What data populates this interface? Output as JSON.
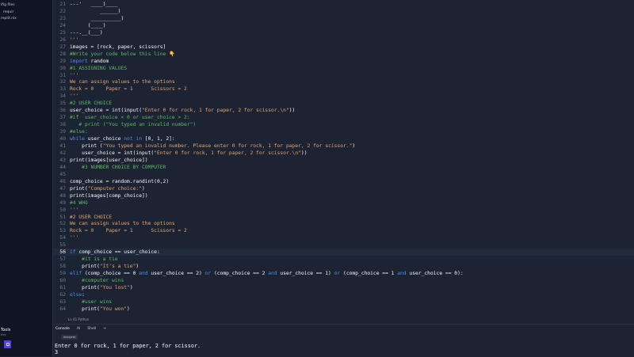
{
  "sidebar": {
    "files": [
      "ifig files",
      "requir",
      "replit.nix"
    ],
    "tools_label": "Tools",
    "tools_small": "nts"
  },
  "editor": {
    "lines": [
      {
        "n": "21",
        "segs": [
          [
            "---'   ____)____",
            "#f5f9fc"
          ]
        ]
      },
      {
        "n": "22",
        "segs": [
          [
            "          ______)",
            "#f5f9fc"
          ]
        ]
      },
      {
        "n": "23",
        "segs": [
          [
            "       __________)",
            "#f5f9fc"
          ]
        ]
      },
      {
        "n": "24",
        "segs": [
          [
            "      (____)",
            "#f5f9fc"
          ]
        ]
      },
      {
        "n": "25",
        "segs": [
          [
            "---.__(___)",
            "#f5f9fc"
          ]
        ]
      },
      {
        "n": "26",
        "segs": [
          [
            "'''",
            "#e8a56a"
          ]
        ]
      },
      {
        "n": "27",
        "segs": [
          [
            "images = [rock, paper, scissors]",
            "#f5f9fc"
          ]
        ]
      },
      {
        "n": "28",
        "segs": [
          [
            "#Write your code below this line ",
            "#5dbb63"
          ],
          [
            "👇",
            "#ffcc4d"
          ]
        ]
      },
      {
        "n": "29",
        "segs": [
          [
            "import",
            "#4a8ef2"
          ],
          [
            " random",
            "#f5f9fc"
          ]
        ]
      },
      {
        "n": "30",
        "segs": [
          [
            "#1 ASSIGNING VALUES",
            "#5dbb63"
          ]
        ]
      },
      {
        "n": "31",
        "segs": [
          [
            "'''",
            "#e8a56a"
          ]
        ]
      },
      {
        "n": "32",
        "segs": [
          [
            "We can assign values to the options",
            "#e8a56a"
          ]
        ]
      },
      {
        "n": "33",
        "segs": [
          [
            "Rock = 0    Paper = 1      Scissors = 2",
            "#e8a56a"
          ]
        ]
      },
      {
        "n": "34",
        "segs": [
          [
            "'''",
            "#e8a56a"
          ]
        ]
      },
      {
        "n": "35",
        "segs": [
          [
            "#2 USER CHOICE",
            "#5dbb63"
          ]
        ]
      },
      {
        "n": "36",
        "segs": [
          [
            "user_choice = int(input(",
            "#f5f9fc"
          ],
          [
            "\"Enter 0 for rock, 1 for paper, 2 for scissor.\\n\"",
            "#e8a56a"
          ],
          [
            "))",
            "#f5f9fc"
          ]
        ]
      },
      {
        "n": "37",
        "segs": [
          [
            "#if  user_choice < 0 or user_choice > 2:",
            "#5dbb63"
          ]
        ]
      },
      {
        "n": "38",
        "segs": [
          [
            "   # print (\"You typed an invalid number\")",
            "#5dbb63"
          ]
        ]
      },
      {
        "n": "39",
        "segs": [
          [
            "#else:",
            "#5dbb63"
          ]
        ]
      },
      {
        "n": "40",
        "segs": [
          [
            "while",
            "#4a8ef2"
          ],
          [
            " user_choice ",
            "#f5f9fc"
          ],
          [
            "not in",
            "#4a8ef2"
          ],
          [
            " [0, 1, 2]:",
            "#f5f9fc"
          ]
        ]
      },
      {
        "n": "41",
        "segs": [
          [
            "    print (",
            "#f5f9fc"
          ],
          [
            "\"You typed an invalid number. Please enter 0 for rock, 1 for paper, 2 for scissor.\"",
            "#e8a56a"
          ],
          [
            ")",
            "#f5f9fc"
          ]
        ]
      },
      {
        "n": "42",
        "segs": [
          [
            "    user_choice = int(input(",
            "#f5f9fc"
          ],
          [
            "\"Enter 0 for rock, 1 for paper, 2 for scissor.\\n\"",
            "#e8a56a"
          ],
          [
            "))",
            "#f5f9fc"
          ]
        ]
      },
      {
        "n": "43",
        "segs": [
          [
            "print(images[user_choice])",
            "#f5f9fc"
          ]
        ]
      },
      {
        "n": "44",
        "segs": [
          [
            "    #3 NUMBER CHOICE BY COMPUTER",
            "#5dbb63"
          ]
        ]
      },
      {
        "n": "45",
        "segs": [
          [
            "",
            "#f5f9fc"
          ]
        ]
      },
      {
        "n": "46",
        "segs": [
          [
            "comp_choice = random.randint(0,2)",
            "#f5f9fc"
          ]
        ]
      },
      {
        "n": "47",
        "segs": [
          [
            "print(",
            "#f5f9fc"
          ],
          [
            "\"Computer choice:\"",
            "#e8a56a"
          ],
          [
            ")",
            "#f5f9fc"
          ]
        ]
      },
      {
        "n": "48",
        "segs": [
          [
            "print(images[comp_choice])",
            "#f5f9fc"
          ]
        ]
      },
      {
        "n": "49",
        "segs": [
          [
            "#4 WHO",
            "#5dbb63"
          ]
        ]
      },
      {
        "n": "50",
        "segs": [
          [
            "'''",
            "#e8a56a"
          ]
        ]
      },
      {
        "n": "51",
        "segs": [
          [
            "#2 USER CHOICE",
            "#e8a56a"
          ]
        ]
      },
      {
        "n": "52",
        "segs": [
          [
            "We can assign values to the options",
            "#e8a56a"
          ]
        ]
      },
      {
        "n": "53",
        "segs": [
          [
            "Rock = 0    Paper = 1      Scissors = 2",
            "#e8a56a"
          ]
        ]
      },
      {
        "n": "54",
        "segs": [
          [
            "'''",
            "#e8a56a"
          ]
        ]
      },
      {
        "n": "55",
        "segs": [
          [
            "",
            "#f5f9fc"
          ]
        ]
      },
      {
        "n": "56",
        "active": true,
        "segs": [
          [
            "if",
            "#4a8ef2"
          ],
          [
            " comp_choice == user_choice:",
            "#f5f9fc"
          ]
        ]
      },
      {
        "n": "57",
        "segs": [
          [
            "    #it is a tie",
            "#5dbb63"
          ]
        ]
      },
      {
        "n": "58",
        "segs": [
          [
            "    print(",
            "#f5f9fc"
          ],
          [
            "\"It's a tie\"",
            "#e8a56a"
          ],
          [
            ")",
            "#f5f9fc"
          ]
        ]
      },
      {
        "n": "59",
        "segs": [
          [
            "elif",
            "#4a8ef2"
          ],
          [
            " (comp_choice == 0 ",
            "#f5f9fc"
          ],
          [
            "and",
            "#4a8ef2"
          ],
          [
            " user_choice == 2) ",
            "#f5f9fc"
          ],
          [
            "or",
            "#4a8ef2"
          ],
          [
            " (comp_choice == 2 ",
            "#f5f9fc"
          ],
          [
            "and",
            "#4a8ef2"
          ],
          [
            " user_choice == 1) ",
            "#f5f9fc"
          ],
          [
            "or",
            "#4a8ef2"
          ],
          [
            " (comp_choice == 1 ",
            "#f5f9fc"
          ],
          [
            "and",
            "#4a8ef2"
          ],
          [
            " user_choice == 0):",
            "#f5f9fc"
          ]
        ]
      },
      {
        "n": "60",
        "segs": [
          [
            "    #computer wins",
            "#5dbb63"
          ]
        ]
      },
      {
        "n": "61",
        "segs": [
          [
            "    print(",
            "#f5f9fc"
          ],
          [
            "\"You lost\"",
            "#e8a56a"
          ],
          [
            ")",
            "#f5f9fc"
          ]
        ]
      },
      {
        "n": "62",
        "segs": [
          [
            "else",
            "#4a8ef2"
          ],
          [
            ":",
            "#f5f9fc"
          ]
        ]
      },
      {
        "n": "63",
        "segs": [
          [
            "    #user wins",
            "#5dbb63"
          ]
        ]
      },
      {
        "n": "64",
        "segs": [
          [
            "    print(",
            "#f5f9fc"
          ],
          [
            "\"You won\"",
            "#e8a56a"
          ],
          [
            ")",
            "#f5f9fc"
          ]
        ]
      }
    ]
  },
  "status": {
    "text": "Ln 41  Python"
  },
  "console": {
    "tabs": [
      "Console",
      "AI",
      "Shell"
    ],
    "extra_tab": "+",
    "pill": "Interpret",
    "output": [
      "Enter 0 for rock, 1 for paper, 2 for scissor.",
      "3"
    ]
  },
  "colors": {
    "background": "#1c2333",
    "keyword": "#4a8ef2",
    "string": "#e8a56a",
    "comment": "#5dbb63"
  }
}
